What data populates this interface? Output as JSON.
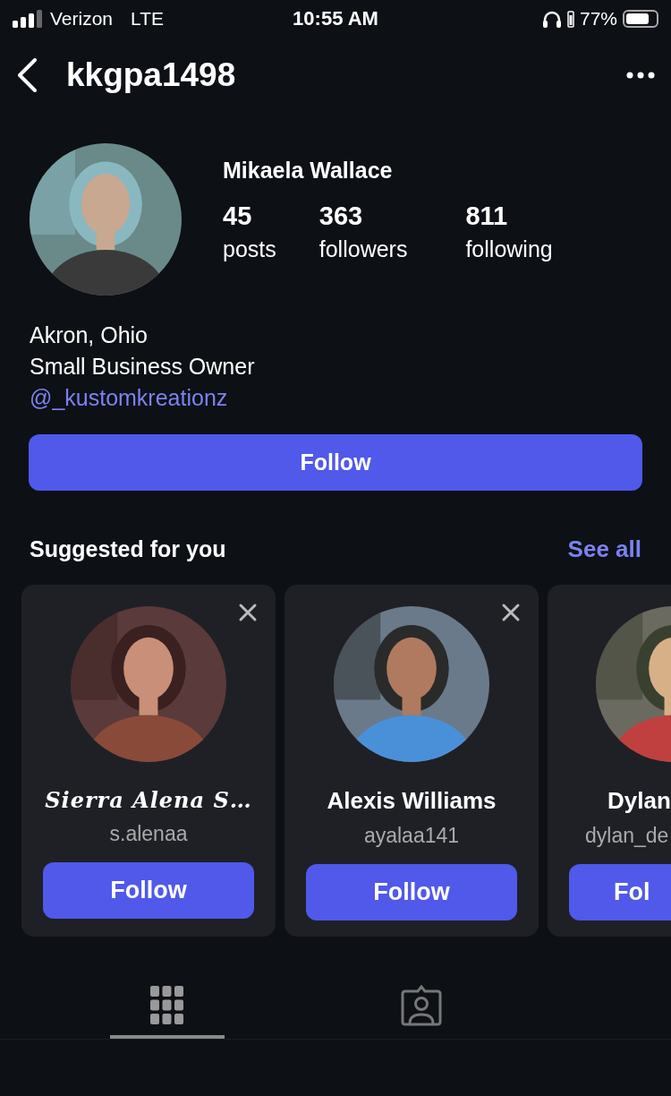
{
  "status_bar": {
    "carrier": "Verizon",
    "network": "LTE",
    "time": "10:55 AM",
    "battery_percent": "77%"
  },
  "header": {
    "username": "kkgpa1498"
  },
  "profile": {
    "avatar": {
      "kind": "picture"
    },
    "name": "Mikaela Wallace",
    "stats": [
      {
        "value": "45",
        "label": "posts"
      },
      {
        "value": "363",
        "label": "followers"
      },
      {
        "value": "811",
        "label": "following"
      }
    ],
    "bio": [
      "Akron, Ohio",
      "Small Business Owner"
    ],
    "link": "@_kustomkreationz",
    "follow_button": "Follow"
  },
  "suggested": {
    "title": "Suggested for you",
    "see_all": "See all",
    "cards": [
      {
        "name": "Sierra Alena S…",
        "script": true,
        "username": "s.alenaa",
        "button": "Follow",
        "dismissable": true,
        "cut": false
      },
      {
        "name": "Alexis Williams",
        "script": false,
        "username": "ayalaa141",
        "button": "Follow",
        "dismissable": true,
        "cut": false
      },
      {
        "name": "Dylan",
        "script": false,
        "username": "dylan_de",
        "button": "Fol",
        "dismissable": false,
        "cut": true
      }
    ]
  },
  "tabs": [
    {
      "kind": "grid",
      "selected": true
    },
    {
      "kind": "tagged",
      "selected": false
    }
  ]
}
